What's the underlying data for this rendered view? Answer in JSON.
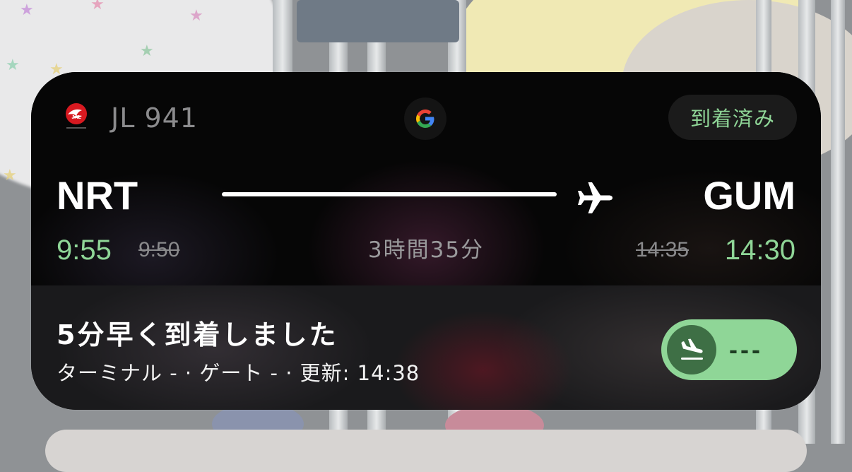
{
  "activity": {
    "flight_number": "JL 941",
    "airline_logo_icon": "jal-crane-logo-icon",
    "provider_icon": "google-g-icon",
    "status": "到着済み",
    "route": {
      "origin": "NRT",
      "destination": "GUM",
      "plane_icon": "airplane-icon"
    },
    "times": {
      "departure_actual": "9:55",
      "departure_scheduled": "9:50",
      "duration": "3時間35分",
      "arrival_scheduled": "14:35",
      "arrival_actual": "14:30"
    },
    "headline": "5分早く到着しました",
    "details": "ターミナル - · ゲート - · 更新: 14:38",
    "progress": {
      "icon": "plane-landing-icon",
      "label": "---"
    }
  },
  "colors": {
    "accent_green": "#8fd697",
    "card_background": "#080808",
    "muted_text": "#8b8b8d",
    "jal_red": "#d71920"
  }
}
